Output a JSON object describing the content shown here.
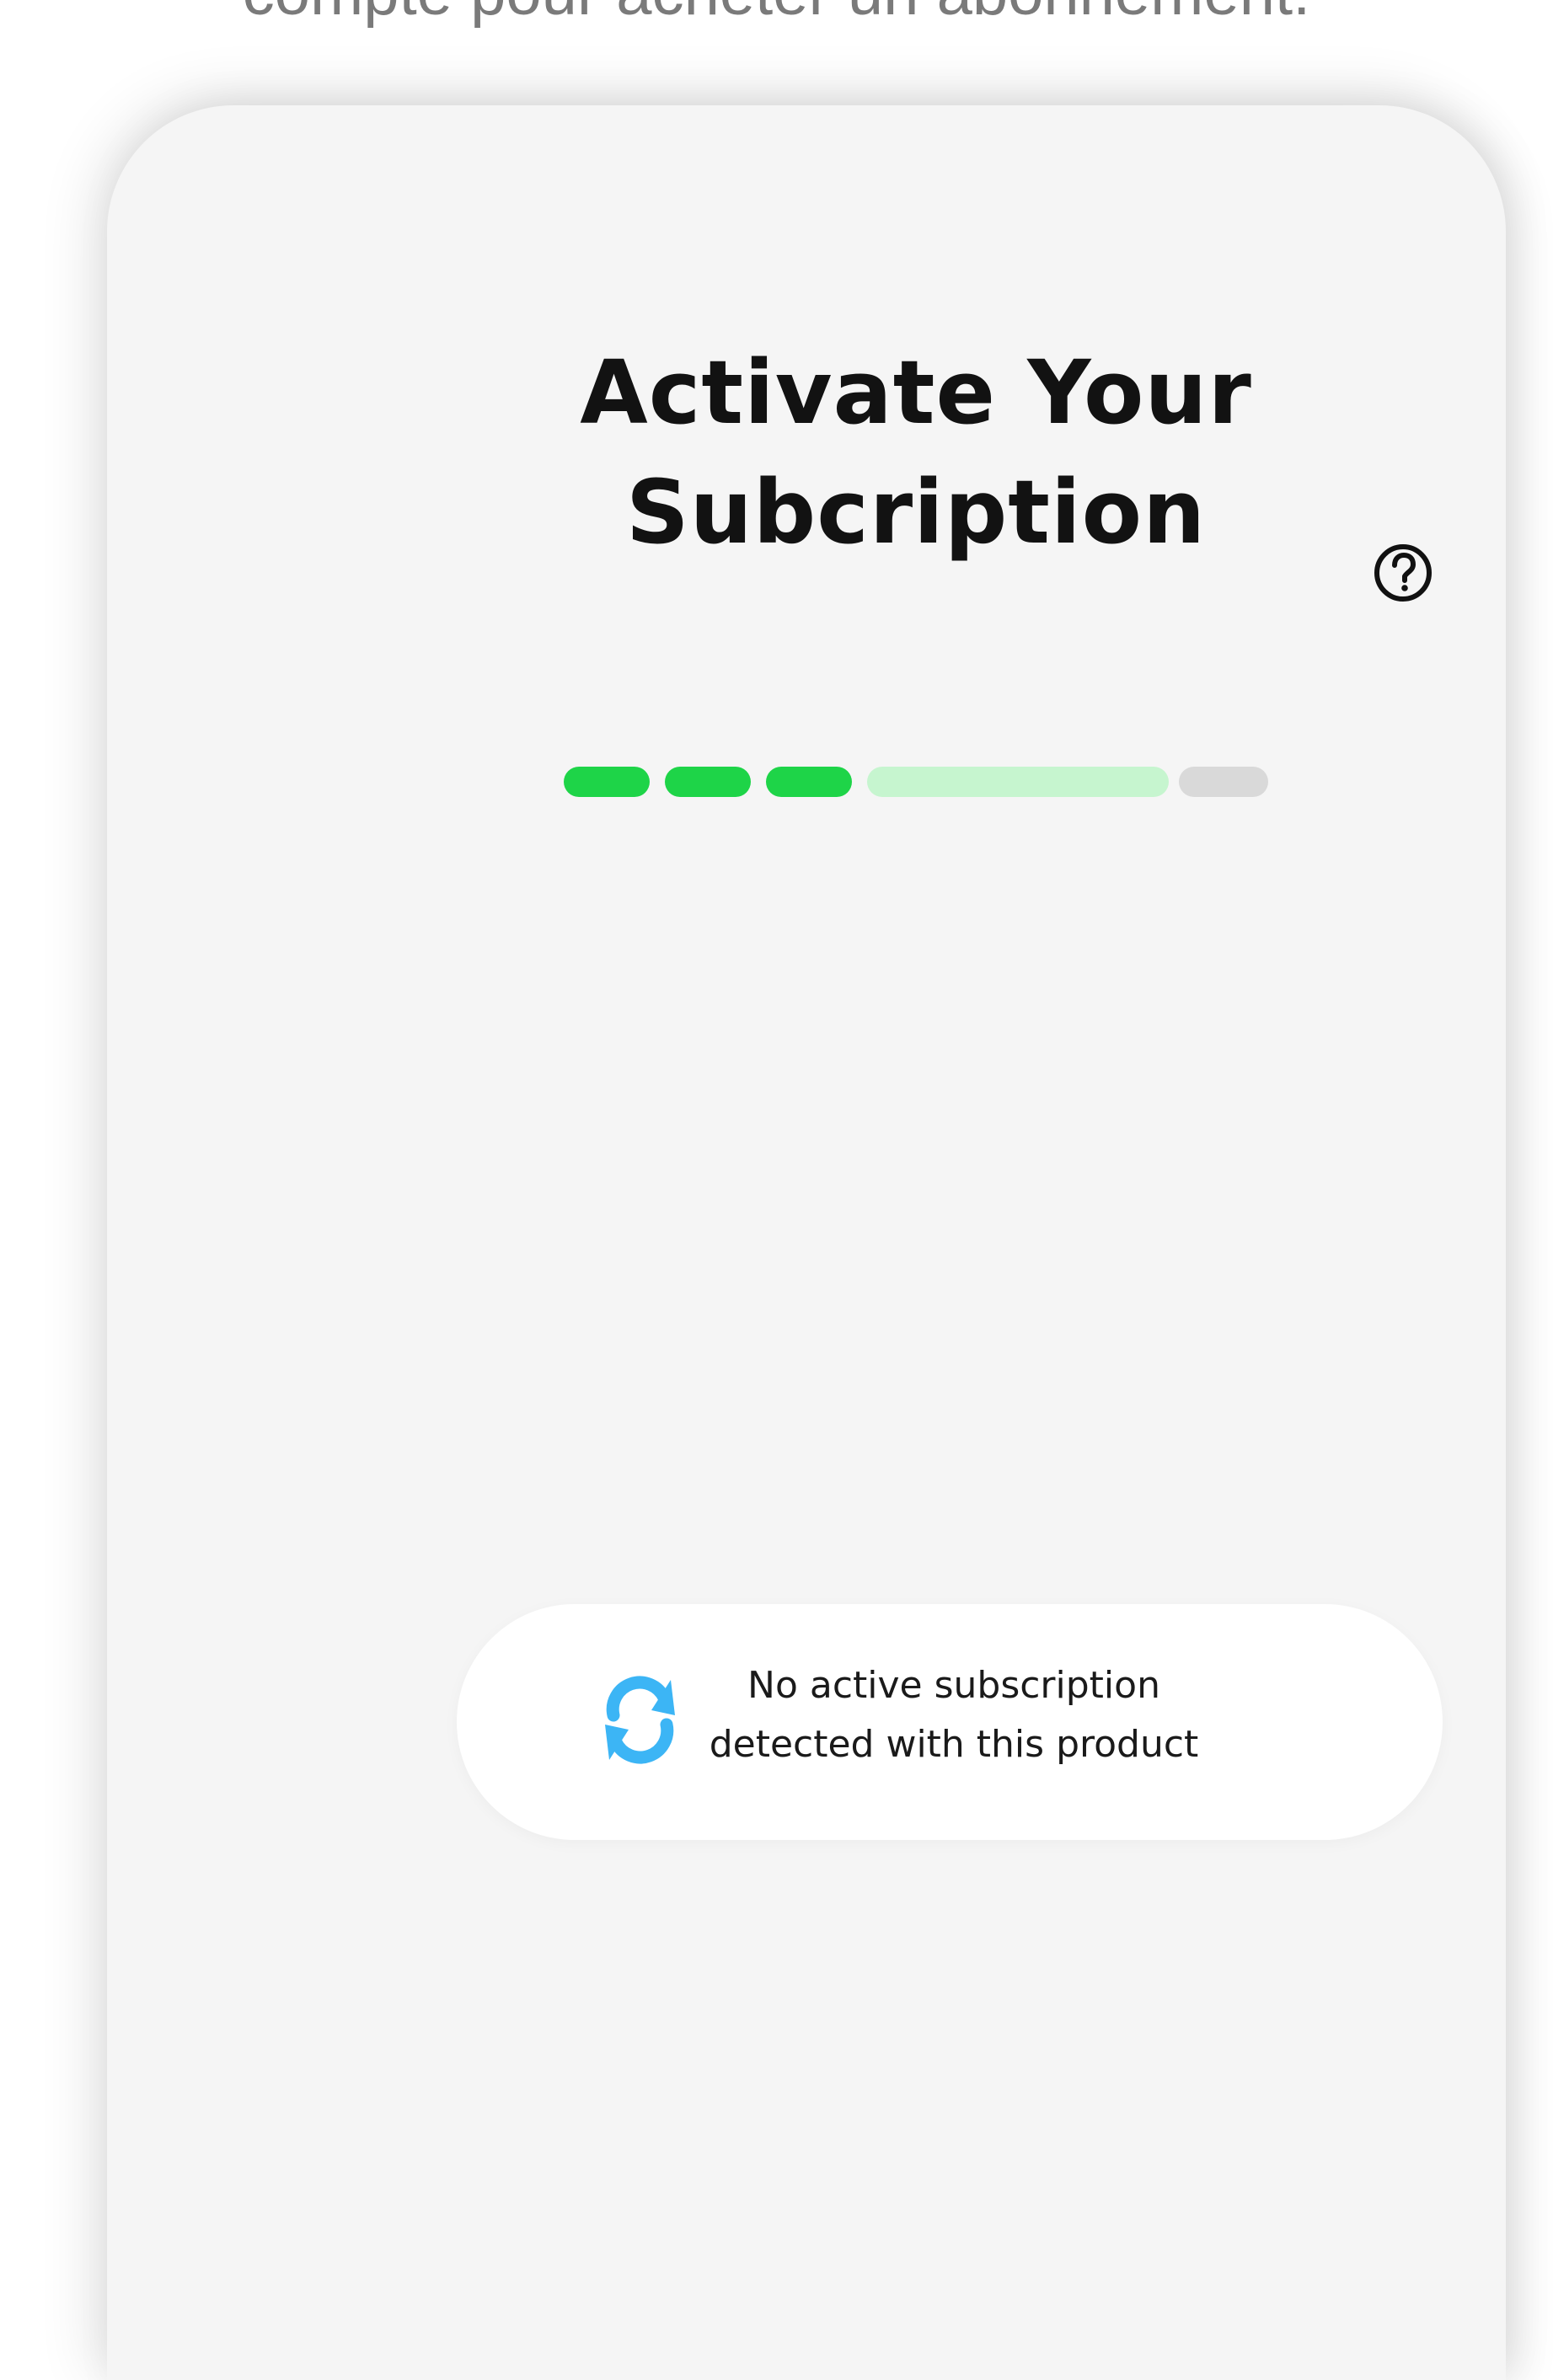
{
  "background_caption": "compte pour acheter un abonnement.",
  "screen": {
    "title": "Activate Your Subcription"
  },
  "progress": {
    "total_steps": 5,
    "completed_steps": 3,
    "current_step": 4,
    "colors": {
      "completed": "#1ed448",
      "current": "#c6f5cf",
      "upcoming": "#d9d9d9"
    }
  },
  "help": {
    "icon": "question-circle-icon"
  },
  "status": {
    "icon": "sync-arrows-icon",
    "icon_color": "#3cb5f5",
    "message": "No active subscription\ndetected with this product"
  },
  "colors": {
    "screen_background": "#f5f5f5",
    "title_text": "#121212",
    "toast_background": "#ffffff"
  }
}
